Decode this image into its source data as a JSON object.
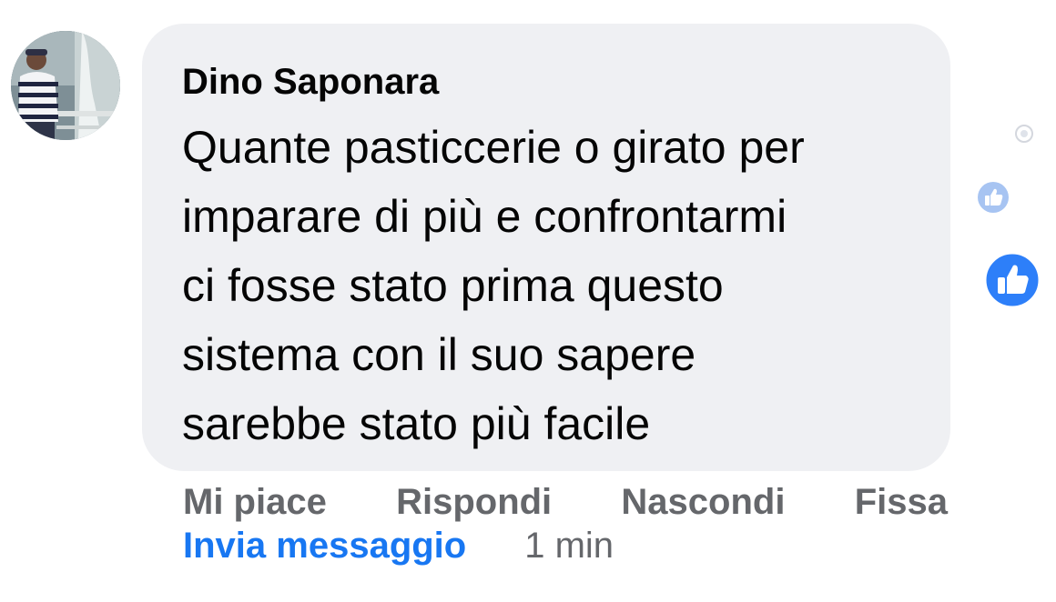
{
  "comment": {
    "author": "Dino Saponara",
    "text_lines": [
      "Quante pasticcerie o girato per",
      "imparare di più e confrontarmi",
      "ci fosse stato prima questo",
      "sistema con il suo sapere",
      "sarebbe stato più facile"
    ]
  },
  "actions": {
    "like": "Mi piace",
    "reply": "Rispondi",
    "hide": "Nascondi",
    "pin": "Fissa"
  },
  "meta": {
    "send_message": "Invia messaggio",
    "time": "1 min"
  },
  "icons": {
    "avatar": "avatar-photo",
    "reaction_small": "thumbs-up-icon",
    "reaction_large": "thumbs-up-icon",
    "status": "dot-icon"
  },
  "colors": {
    "bubble": "#eff0f3",
    "action_text": "#65676b",
    "link": "#1877f2",
    "like_blue": "#1877f2"
  }
}
